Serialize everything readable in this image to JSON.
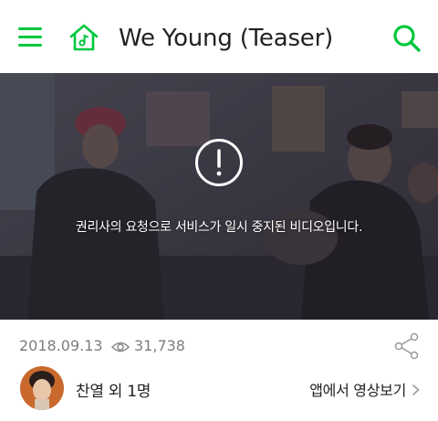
{
  "header": {
    "title": "We Young (Teaser)",
    "accent_color": "#00c73c",
    "icons": [
      "menu-icon",
      "music-home-icon",
      "search-icon"
    ]
  },
  "video": {
    "notice_icon": "exclamation-circle-icon",
    "notice_text": "권리사의 요청으로 서비스가 일시 중지된 비디오입니다."
  },
  "meta": {
    "date": "2018.09.13",
    "views": "31,738",
    "icons": [
      "eye-icon",
      "share-icon"
    ]
  },
  "channel": {
    "artist": "찬열 외 1명",
    "app_link": "앱에서 영상보기"
  }
}
